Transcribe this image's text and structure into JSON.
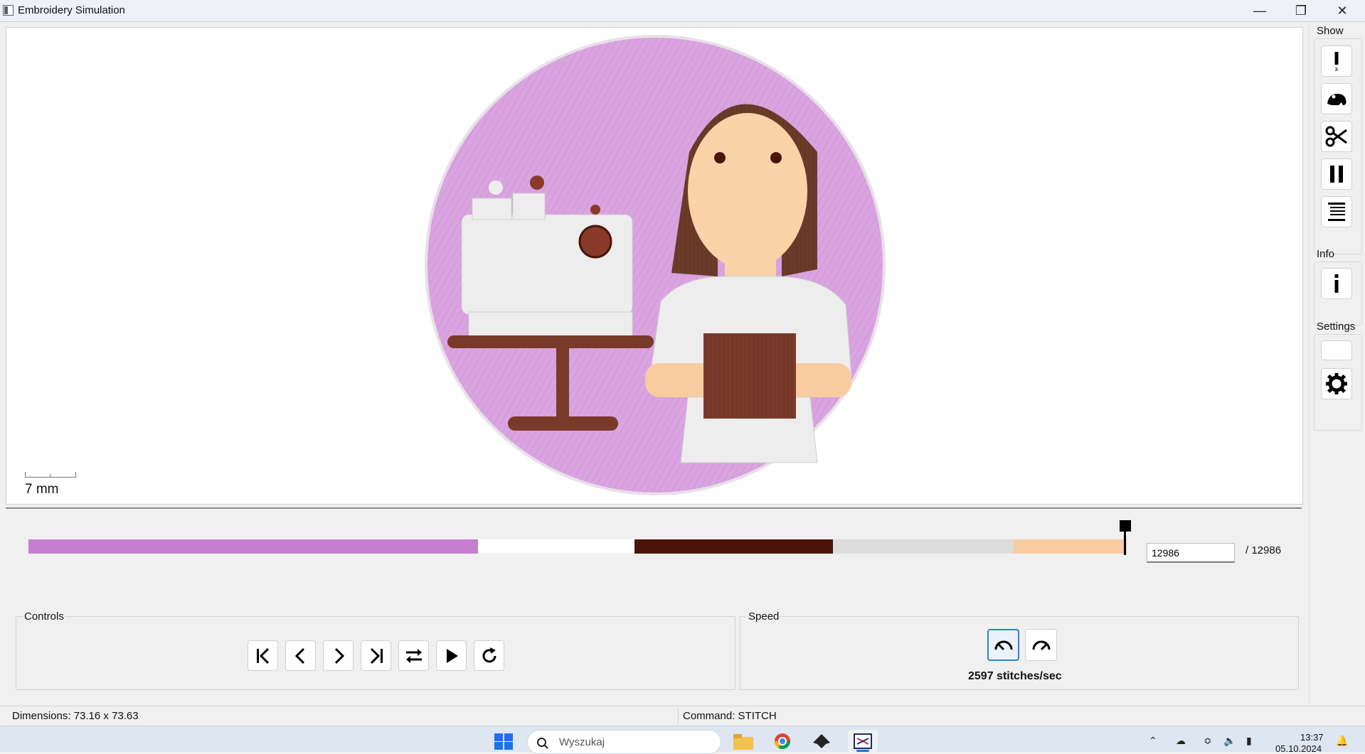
{
  "window": {
    "title": "Embroidery Simulation"
  },
  "canvas": {
    "scale_label": "7 mm"
  },
  "side_panel": {
    "show_label": "Show",
    "info_label": "Info",
    "settings_label": "Settings",
    "show_buttons": [
      "jump-icon",
      "frog-icon",
      "scissors-icon",
      "pause-icon",
      "stop-icon"
    ],
    "info_button": "info-icon",
    "settings_button": "gear-icon"
  },
  "timeline": {
    "current_step": "12986",
    "total_label": "/ 12986",
    "progress": 1.0,
    "colors": [
      "#c57fcf",
      "#ffffff",
      "#4a1408",
      "#dcdcdc",
      "#f8cca0"
    ]
  },
  "controls": {
    "label": "Controls",
    "buttons": [
      "first-icon",
      "prev-icon",
      "next-icon",
      "last-icon",
      "swap-icon",
      "play-icon",
      "restart-icon"
    ]
  },
  "speed": {
    "label": "Speed",
    "value_label": "2597 stitches/sec",
    "buttons": [
      "slower-icon",
      "faster-icon"
    ]
  },
  "status": {
    "dimensions": "Dimensions: 73.16 x 73.63",
    "command": "Command: STITCH"
  },
  "taskbar": {
    "search_placeholder": "Wyszukaj",
    "time": "13:37",
    "date": "05.10.2024"
  }
}
